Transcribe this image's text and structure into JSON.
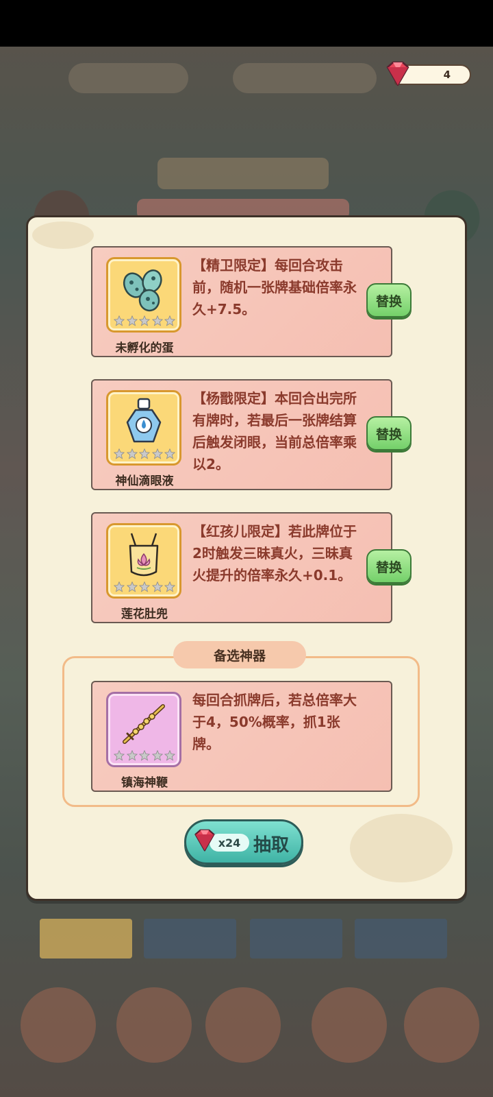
{
  "header": {
    "gem_count": "4",
    "gem_icon": "red-gem-icon"
  },
  "slots": [
    {
      "name": "未孵化的蛋",
      "icon": "eggs-icon",
      "description": "【精卫限定】每回合攻击前，随机一张牌基础倍率永久+7.5。",
      "stars_filled": 0,
      "stars_total": 5,
      "button_label": "替换"
    },
    {
      "name": "神仙滴眼液",
      "icon": "eye-drops-bottle-icon",
      "description": "【杨戬限定】本回合出完所有牌时，若最后一张牌结算后触发闭眼，当前总倍率乘以2。",
      "stars_filled": 0,
      "stars_total": 5,
      "button_label": "替换"
    },
    {
      "name": "莲花肚兜",
      "icon": "lotus-apron-icon",
      "description": "【红孩儿限定】若此牌位于2时触发三昧真火，三昧真火提升的倍率永久+0.1。",
      "stars_filled": 0,
      "stars_total": 5,
      "button_label": "替换"
    }
  ],
  "alternate": {
    "title": "备选神器",
    "item": {
      "name": "镇海神鞭",
      "icon": "golden-whip-icon",
      "description": "每回合抓牌后，若总倍率大于4，50%概率，抓1张牌。",
      "stars_filled": 0,
      "stars_total": 5
    }
  },
  "draw_button": {
    "cost": "x24",
    "label": "抽取",
    "gem_icon": "red-gem-icon"
  },
  "colors": {
    "panel_bg": "#f7f1da",
    "card_bg": "#f7ccc0",
    "desc_text": "#8a3a2c",
    "swap_button": "#74d06a",
    "draw_button": "#3fb3a5"
  }
}
